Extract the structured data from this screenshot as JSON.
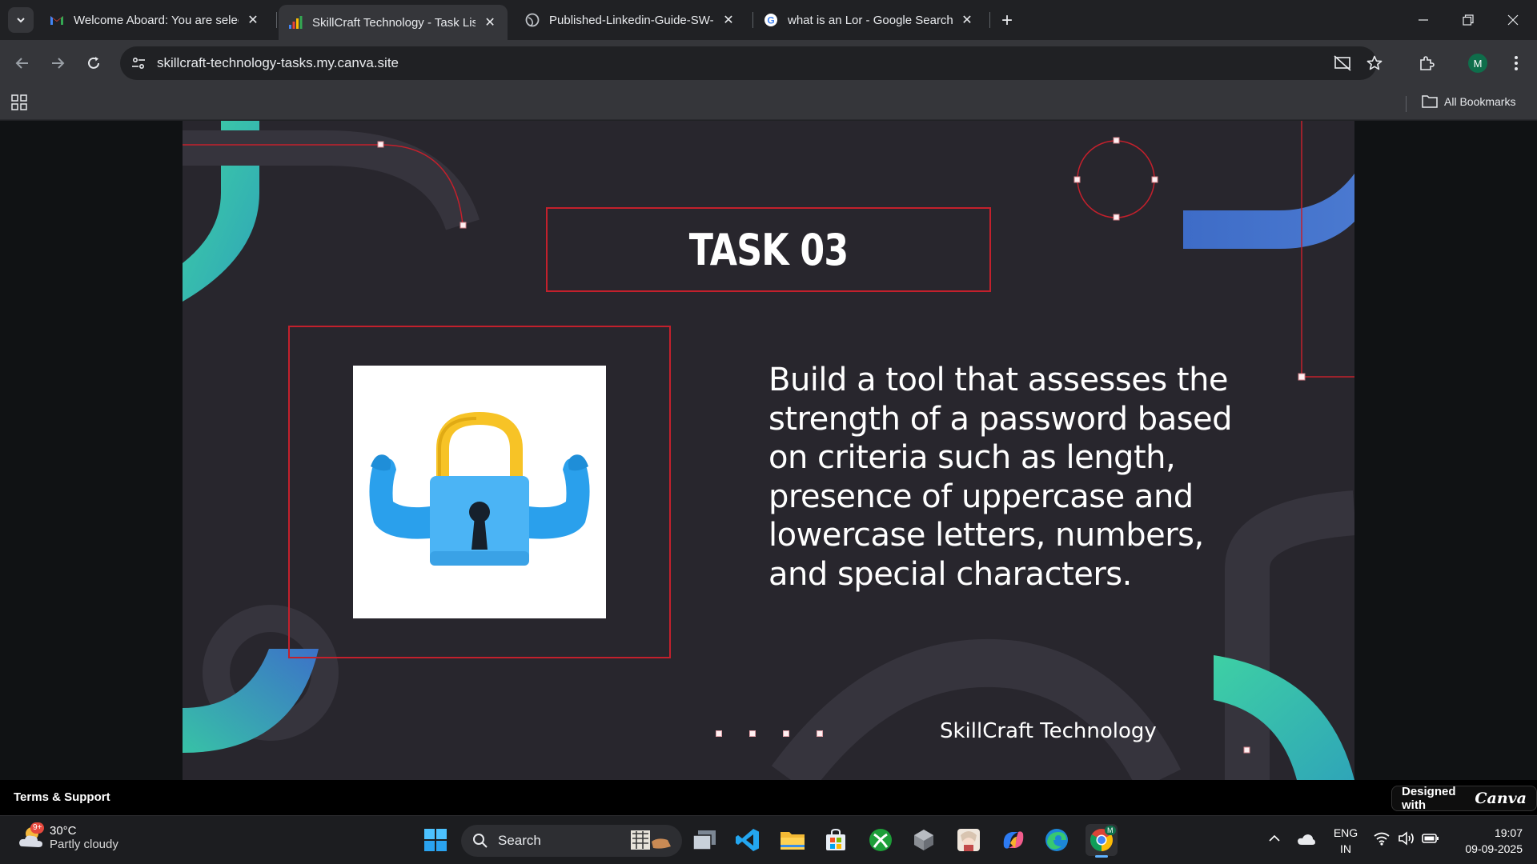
{
  "tabs": [
    {
      "title": "Welcome Aboard: You are selec",
      "favicon": "gmail-icon"
    },
    {
      "title": "SkillCraft Technology - Task List",
      "favicon": "canva-bars-icon",
      "active": true
    },
    {
      "title": "Published-Linkedin-Guide-SW-",
      "favicon": "globe-icon"
    },
    {
      "title": "what is an Lor - Google Search",
      "favicon": "google-icon"
    }
  ],
  "address": {
    "url": "skillcraft-technology-tasks.my.canva.site"
  },
  "profile": {
    "initial": "M"
  },
  "bookmarks": {
    "all_label": "All Bookmarks"
  },
  "slide": {
    "task_title": "TASK 03",
    "description": "Build a tool that assesses the strength of a password based on criteria such as length, presence of uppercase and lowercase letters, numbers, and special characters.",
    "brand": "SkillCraft Technology",
    "accent_color": "#c3202c",
    "teal": "#3cc6a3",
    "blue": "#3a6fc4"
  },
  "footer": {
    "terms": "Terms & Support",
    "designed_with": "Designed with",
    "canva": "Canva"
  },
  "taskbar": {
    "weather_temp": "30°C",
    "weather_cond": "Partly cloudy",
    "weather_badge": "9+",
    "search": "Search",
    "lang_top": "ENG",
    "lang_bottom": "IN",
    "time": "19:07",
    "date": "09-09-2025",
    "chrome_badge": "M"
  }
}
